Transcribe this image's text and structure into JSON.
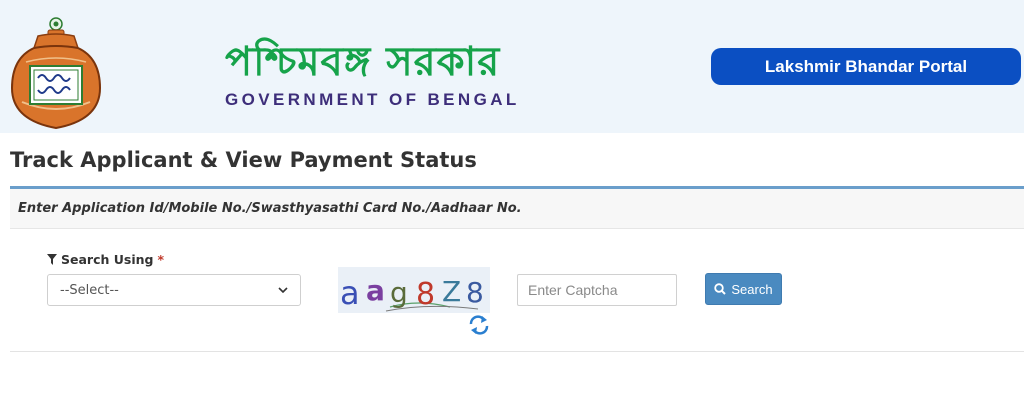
{
  "header": {
    "gov_name_bengali": "পশ্চিমবঙ্গ সরকার",
    "gov_name_english": "GOVERNMENT OF BENGAL",
    "portal_button": "Lakshmir Bhandar Portal",
    "logo_icon": "lakshmir-bhandar-pot-logo"
  },
  "page": {
    "title": "Track Applicant & View Payment Status"
  },
  "panel": {
    "heading": "Enter Application Id/Mobile No./Swasthyasathi Card No./Aadhaar No."
  },
  "form": {
    "search_label": "Search Using",
    "required_mark": "*",
    "select_value": "--Select--",
    "captcha_text": "aag8Z8",
    "captcha_placeholder": "Enter Captcha",
    "search_button": "Search"
  },
  "colors": {
    "header_bg": "#eef5fb",
    "bengali_green": "#16a34a",
    "english_purple": "#3d2e7a",
    "portal_blue": "#0b4fc2",
    "panel_border": "#6a9ecb",
    "search_btn": "#4a8ac0"
  }
}
